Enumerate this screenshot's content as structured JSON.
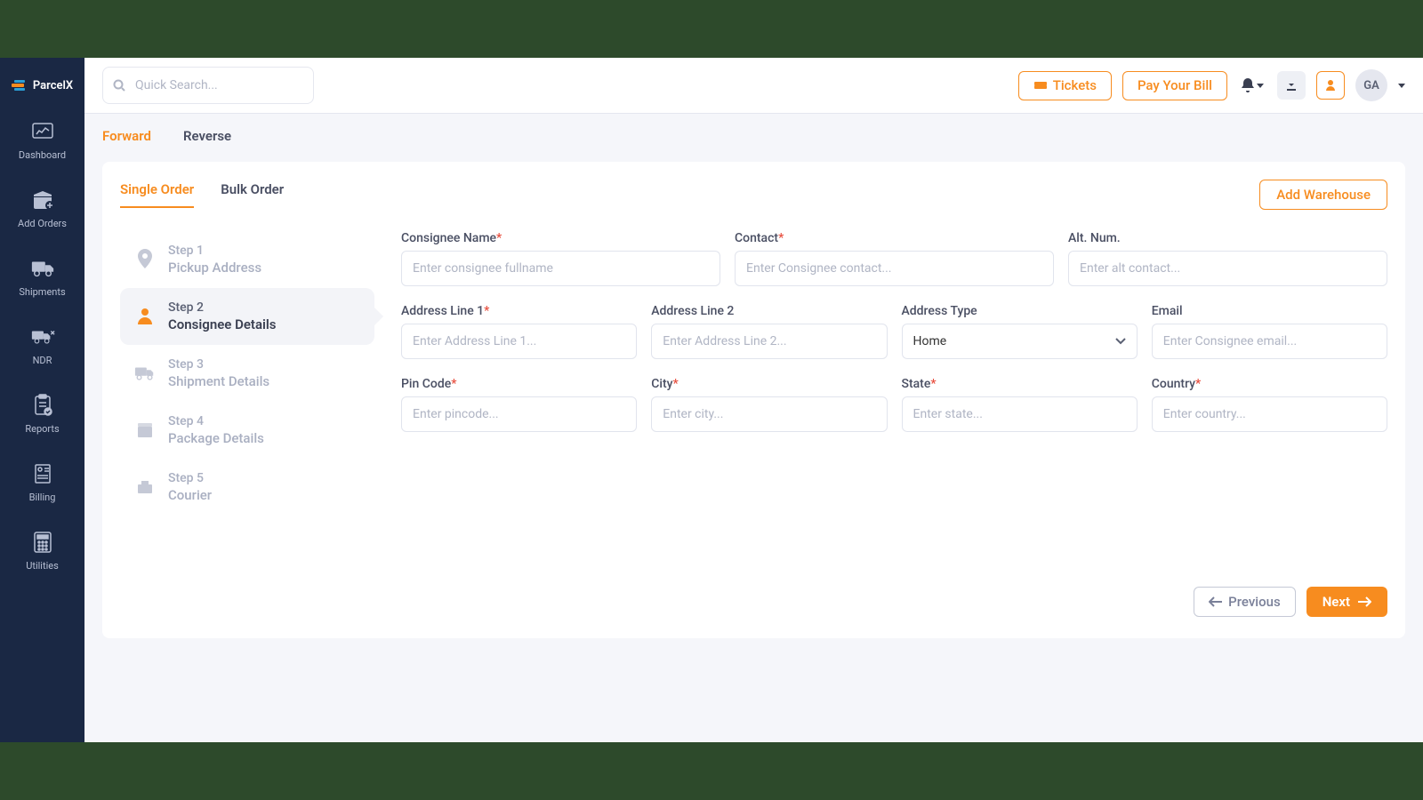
{
  "brand": "ParcelX",
  "search": {
    "placeholder": "Quick Search..."
  },
  "topbar": {
    "tickets": "Tickets",
    "pay_bill": "Pay Your Bill",
    "avatar_initials": "GA"
  },
  "sidebar": {
    "items": [
      {
        "label": "Dashboard"
      },
      {
        "label": "Add Orders"
      },
      {
        "label": "Shipments"
      },
      {
        "label": "NDR"
      },
      {
        "label": "Reports"
      },
      {
        "label": "Billing"
      },
      {
        "label": "Utilities"
      }
    ]
  },
  "top_tabs": {
    "forward": "Forward",
    "reverse": "Reverse"
  },
  "inner_tabs": {
    "single": "Single Order",
    "bulk": "Bulk Order"
  },
  "add_warehouse": "Add Warehouse",
  "steps": [
    {
      "num": "Step 1",
      "title": "Pickup Address"
    },
    {
      "num": "Step 2",
      "title": "Consignee Details"
    },
    {
      "num": "Step 3",
      "title": "Shipment Details"
    },
    {
      "num": "Step 4",
      "title": "Package Details"
    },
    {
      "num": "Step 5",
      "title": "Courier"
    }
  ],
  "fields": {
    "consignee_name": {
      "label": "Consignee Name",
      "placeholder": "Enter consignee fullname",
      "required": true
    },
    "contact": {
      "label": "Contact",
      "placeholder": "Enter Consignee contact...",
      "required": true
    },
    "alt_num": {
      "label": "Alt. Num.",
      "placeholder": "Enter alt contact...",
      "required": false
    },
    "addr1": {
      "label": "Address Line 1",
      "placeholder": "Enter Address Line 1...",
      "required": true
    },
    "addr2": {
      "label": "Address Line 2",
      "placeholder": "Enter Address Line 2...",
      "required": false
    },
    "addr_type": {
      "label": "Address Type",
      "selected": "Home",
      "required": false
    },
    "email": {
      "label": "Email",
      "placeholder": "Enter Consignee email...",
      "required": false
    },
    "pincode": {
      "label": "Pin Code",
      "placeholder": "Enter pincode...",
      "required": true
    },
    "city": {
      "label": "City",
      "placeholder": "Enter city...",
      "required": true
    },
    "state": {
      "label": "State",
      "placeholder": "Enter state...",
      "required": true
    },
    "country": {
      "label": "Country",
      "placeholder": "Enter country...",
      "required": true
    }
  },
  "nav_buttons": {
    "previous": "Previous",
    "next": "Next"
  }
}
